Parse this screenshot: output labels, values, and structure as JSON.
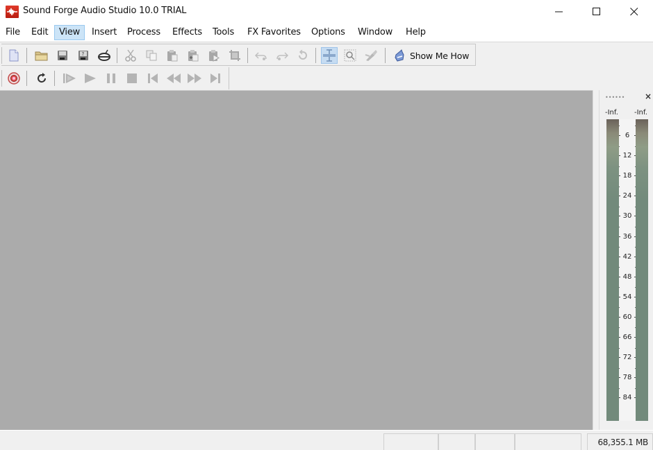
{
  "window": {
    "title": "Sound Forge Audio Studio 10.0 TRIAL",
    "app_icon": "sound-forge-waveform-icon",
    "controls": [
      "minimize-icon",
      "maximize-icon",
      "close-icon"
    ]
  },
  "menubar": {
    "items": [
      {
        "label": "File"
      },
      {
        "label": "Edit"
      },
      {
        "label": "View",
        "active": true
      },
      {
        "label": "Insert"
      },
      {
        "label": "Process"
      },
      {
        "label": "Effects"
      },
      {
        "label": "Tools"
      },
      {
        "label": "FX Favorites"
      },
      {
        "label": "Options"
      },
      {
        "label": "Window"
      },
      {
        "label": "Help"
      }
    ]
  },
  "toolbar_standard": {
    "buttons": [
      {
        "icon": "new-file-icon",
        "enabled": true
      },
      {
        "icon": "open-folder-icon",
        "enabled": true
      },
      {
        "icon": "save-icon",
        "enabled": true
      },
      {
        "icon": "save-as-icon",
        "enabled": true
      },
      {
        "icon": "render-as-icon",
        "enabled": true
      },
      {
        "icon": "cut-icon",
        "enabled": false
      },
      {
        "icon": "copy-icon",
        "enabled": false
      },
      {
        "icon": "paste-icon",
        "enabled": false
      },
      {
        "icon": "mix-paste-icon",
        "enabled": false
      },
      {
        "icon": "paste-play-icon",
        "enabled": false
      },
      {
        "icon": "trim-crop-icon",
        "enabled": false
      },
      {
        "icon": "undo-icon",
        "enabled": false
      },
      {
        "icon": "redo-icon",
        "enabled": false
      },
      {
        "icon": "repeat-icon",
        "enabled": false
      },
      {
        "icon": "edit-tool-icon",
        "enabled": true,
        "pressed": true
      },
      {
        "icon": "magnify-tool-icon",
        "enabled": true
      },
      {
        "icon": "pencil-tool-icon",
        "enabled": false
      }
    ],
    "show_me_how_label": "Show Me How"
  },
  "toolbar_transport": {
    "buttons": [
      {
        "icon": "record-icon",
        "enabled": true
      },
      {
        "icon": "loop-playback-icon",
        "enabled": true
      },
      {
        "icon": "play-all-icon",
        "enabled": false
      },
      {
        "icon": "play-icon",
        "enabled": false
      },
      {
        "icon": "pause-icon",
        "enabled": false
      },
      {
        "icon": "stop-icon",
        "enabled": false
      },
      {
        "icon": "go-to-start-icon",
        "enabled": false
      },
      {
        "icon": "rewind-icon",
        "enabled": false
      },
      {
        "icon": "fast-forward-icon",
        "enabled": false
      },
      {
        "icon": "go-to-end-icon",
        "enabled": false
      }
    ]
  },
  "meters": {
    "peak_left": "-Inf.",
    "peak_right": "-Inf.",
    "scale_labels": [
      "6",
      "12",
      "18",
      "24",
      "30",
      "36",
      "42",
      "48",
      "54",
      "60",
      "66",
      "72",
      "78",
      "84"
    ],
    "level_left_db": null,
    "level_right_db": null
  },
  "statusbar": {
    "disk_space": "68,355.1 MB"
  }
}
